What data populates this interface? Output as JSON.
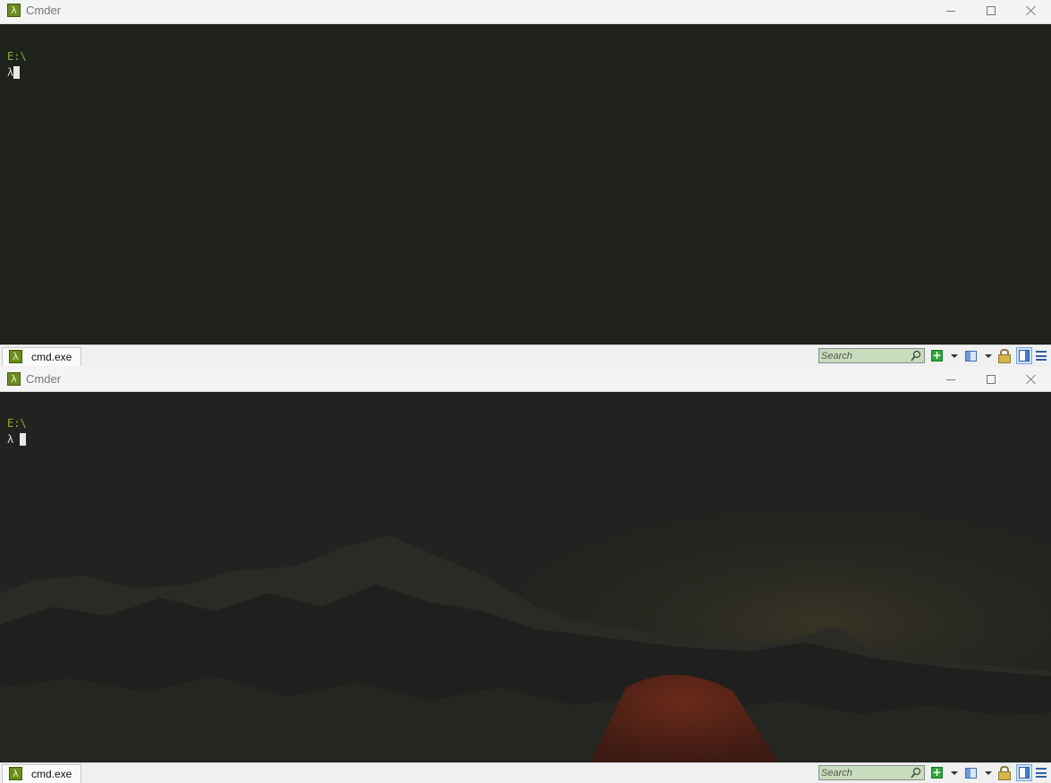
{
  "windows": [
    {
      "title": "Cmder",
      "app_icon_glyph": "λ",
      "console": {
        "path": "E:\\",
        "prompt": "λ"
      },
      "tab": {
        "icon_glyph": "λ",
        "label": "cmd.exe"
      },
      "search": {
        "placeholder": "Search"
      }
    },
    {
      "title": "Cmder",
      "app_icon_glyph": "λ",
      "console": {
        "path": "E:\\",
        "prompt": "λ "
      },
      "tab": {
        "icon_glyph": "λ",
        "label": "cmd.exe"
      },
      "search": {
        "placeholder": "Search"
      }
    }
  ],
  "toolbar_icons": [
    "new-console-icon",
    "dropdown-arrow-icon",
    "split-view-icon",
    "dropdown-arrow-icon",
    "lock-icon",
    "view-toggle-icon",
    "menu-icon"
  ],
  "colors": {
    "accent_green": "#6b8d1f",
    "path_text": "#8ab23a",
    "console_bg": "#1f211d",
    "search_bg": "#c8ddbc"
  }
}
